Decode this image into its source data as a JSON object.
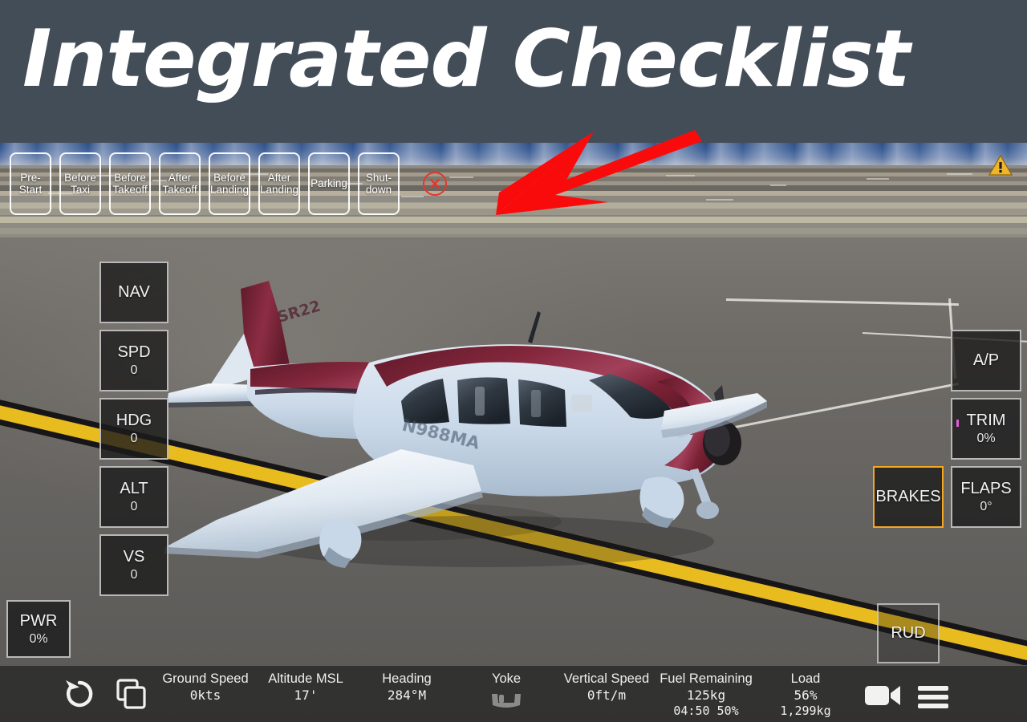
{
  "banner": {
    "title": "Integrated Checklist",
    "background_color": "#434d57",
    "text_color": "#ffffff"
  },
  "checklist": {
    "tabs": [
      {
        "label": "Pre-\nStart",
        "name": "pre-start"
      },
      {
        "label": "Before\nTaxi",
        "name": "before-taxi"
      },
      {
        "label": "Before\nTakeoff",
        "name": "before-takeoff"
      },
      {
        "label": "After\nTakeoff",
        "name": "after-takeoff"
      },
      {
        "label": "Before\nLanding",
        "name": "before-landing"
      },
      {
        "label": "After\nLanding",
        "name": "after-landing"
      },
      {
        "label": "Parking",
        "name": "parking"
      },
      {
        "label": "Shut-\ndown",
        "name": "shutdown"
      }
    ],
    "close_label": "x",
    "close_color": "#e8352c"
  },
  "annotation": {
    "arrow_color": "#fa0b0b",
    "points_to": "checklist-close-button"
  },
  "warning": {
    "glyph": "!",
    "color": "#f0b429"
  },
  "left_controls": [
    {
      "name": "nav",
      "label": "NAV",
      "value": ""
    },
    {
      "name": "spd",
      "label": "SPD",
      "value": "0"
    },
    {
      "name": "hdg",
      "label": "HDG",
      "value": "0"
    },
    {
      "name": "alt",
      "label": "ALT",
      "value": "0"
    },
    {
      "name": "vs",
      "label": "VS",
      "value": "0"
    }
  ],
  "right_controls": [
    {
      "name": "ap",
      "label": "A/P",
      "value": ""
    },
    {
      "name": "trim",
      "label": "TRIM",
      "value": "0%"
    },
    {
      "name": "flaps",
      "label": "FLAPS",
      "value": "0°"
    }
  ],
  "brakes": {
    "label": "BRAKES",
    "value": "",
    "state": "active",
    "accent_color": "#f5a623"
  },
  "power": {
    "label": "PWR",
    "value": "0%"
  },
  "rudder": {
    "label": "RUD",
    "value": ""
  },
  "status_bar": {
    "icons": {
      "reset": "reset-icon",
      "duplicate": "duplicate-icon",
      "camera": "camera-icon",
      "menu": "hamburger-menu-icon"
    },
    "fields": [
      {
        "name": "ground-speed",
        "label": "Ground Speed",
        "value": "0kts",
        "sub": ""
      },
      {
        "name": "altitude-msl",
        "label": "Altitude MSL",
        "value": "17'",
        "sub": ""
      },
      {
        "name": "heading",
        "label": "Heading",
        "value": "284°M",
        "sub": ""
      },
      {
        "name": "yoke",
        "label": "Yoke",
        "value": "",
        "sub": ""
      },
      {
        "name": "vertical-speed",
        "label": "Vertical Speed",
        "value": "0ft/m",
        "sub": ""
      },
      {
        "name": "fuel-remaining",
        "label": "Fuel Remaining",
        "value": "125kg",
        "sub": "04:50  50%"
      },
      {
        "name": "load",
        "label": "Load",
        "value": "56%",
        "sub": "1,299kg"
      }
    ]
  },
  "aircraft": {
    "model": "SR22",
    "registration": "N988MA",
    "body_color": "#7c2236",
    "lower_color": "#cfdbe8"
  }
}
